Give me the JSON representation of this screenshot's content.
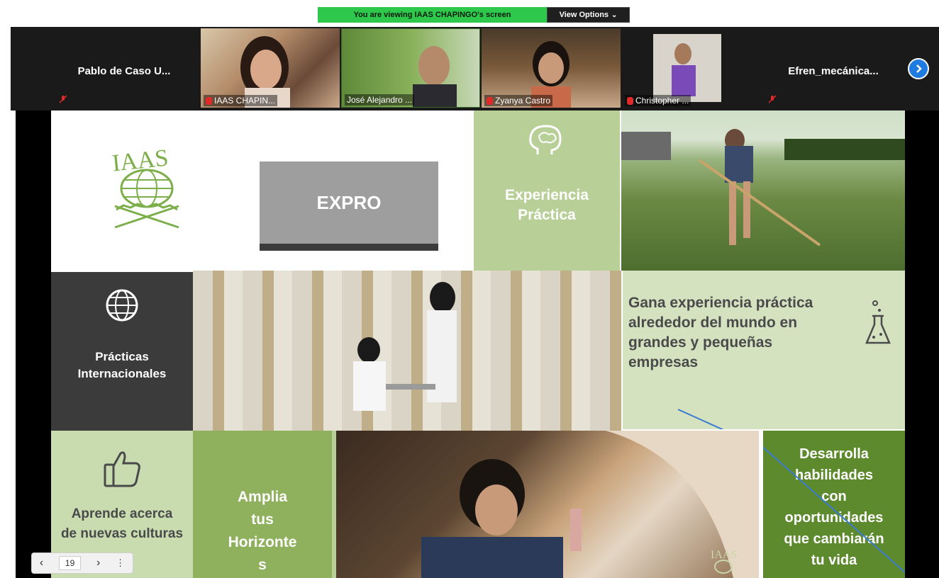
{
  "banner": {
    "viewing_text": "You are viewing IAAS CHAPINGO's screen",
    "options_label": "View Options",
    "options_chevron": "⌄"
  },
  "participants": [
    {
      "name": "Pablo de Caso U...",
      "video": false
    },
    {
      "name": "IAAS CHAPIN...",
      "video": true
    },
    {
      "name": "José Alejandro ...",
      "video": true
    },
    {
      "name": "Zyanya Castro",
      "video": true
    },
    {
      "name": "Christopher ...",
      "video": true
    },
    {
      "name": "Efren_mecánica...",
      "video": false
    }
  ],
  "next_icon": "next-page-icon",
  "slide": {
    "logo_text": "IAAS",
    "title": "EXPRO",
    "experiencia": [
      "Experiencia",
      "Práctica"
    ],
    "practicas": [
      "Prácticas",
      "Internacionales"
    ],
    "gana": [
      "Gana experiencia práctica",
      "alrededor del mundo en",
      "grandes y pequeñas",
      "empresas"
    ],
    "aprende": [
      "Aprende acerca",
      "de nuevas culturas"
    ],
    "amplia": [
      "Amplia",
      "tus",
      "Horizonte",
      "s"
    ],
    "desarrolla": [
      "Desarrolla",
      "habilidades",
      "con",
      "oportunidades",
      "que cambiarán",
      "tu vida"
    ],
    "cow_logo_text": "IAAS"
  },
  "pager": {
    "prev": "‹",
    "page": "19",
    "next": "›",
    "more": "⋮"
  },
  "colors": {
    "light_green": "#b8cf98",
    "mid_green": "#8fb05c",
    "dark_green": "#5e8a2e",
    "dark_panel": "#3b3b3b",
    "gray_box": "#9e9e9e",
    "zoom_green": "#2ec84c",
    "zoom_blue": "#1f7be0"
  }
}
